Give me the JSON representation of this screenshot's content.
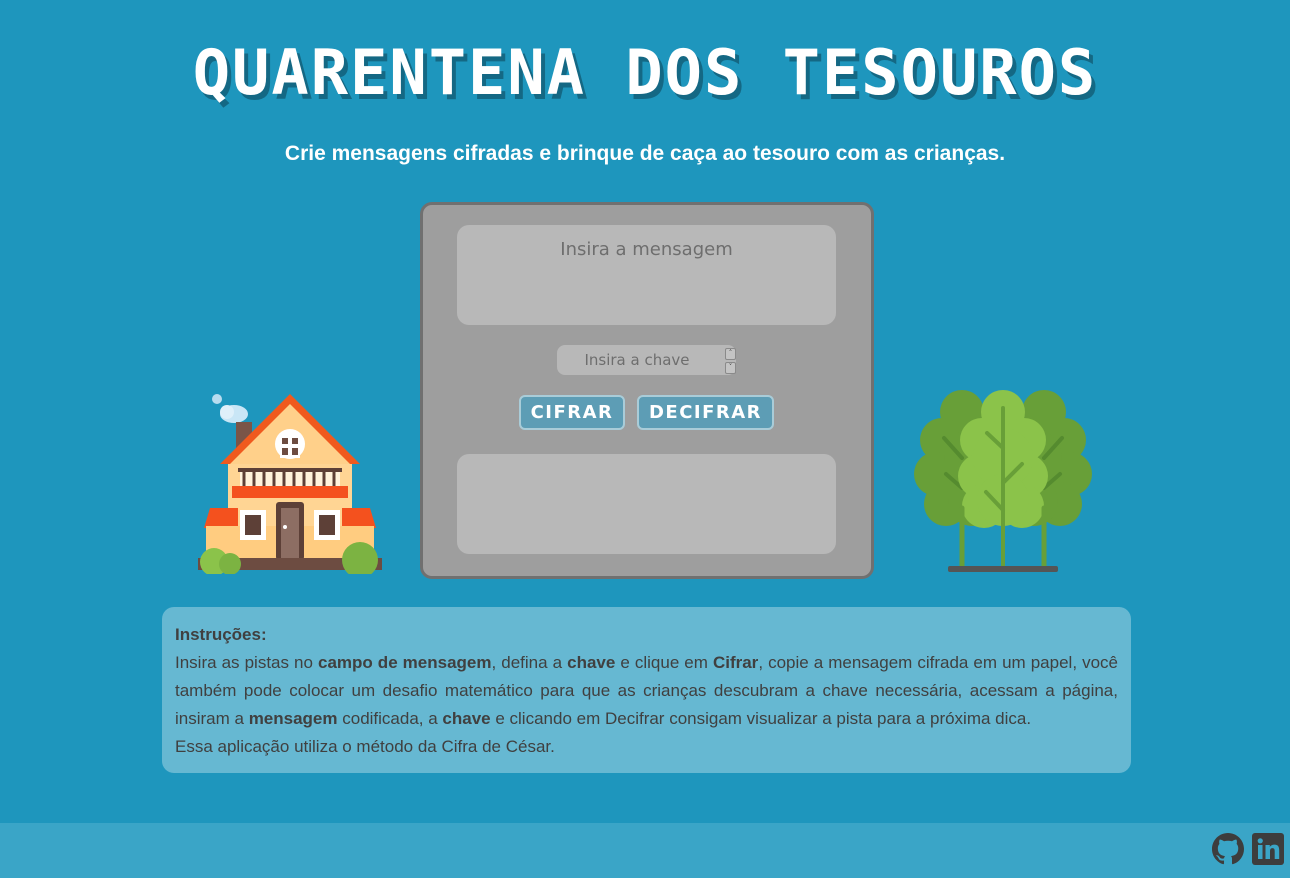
{
  "header": {
    "title": "QUARENTENA DOS TESOUROS",
    "subtitle": "Crie mensagens cifradas e brinque de caça ao tesouro com as crianças."
  },
  "cipher": {
    "message_placeholder": "Insira a mensagem",
    "message_value": "",
    "key_placeholder": "Insira a chave",
    "key_value": "",
    "encrypt_label": "CIFRAR",
    "decrypt_label": "DECIFRAR",
    "output_value": ""
  },
  "instructions": {
    "heading": "Instruções:",
    "segments": [
      "Insira as pistas no ",
      "campo de mensagem",
      ", defina a ",
      "chave",
      " e clique em ",
      "Cifrar",
      ", copie a mensagem cifrada em um papel, você também pode colocar um desafio matemático para que as crianças descubram a chave necessária, acessam a página, insiram a ",
      "mensagem",
      " codificada, a ",
      "chave",
      " e clicando em Decifrar consigam visualizar a pista para a próxima dica."
    ],
    "note": "Essa aplicação utiliza o método da Cifra de César."
  },
  "footer": {
    "icons": [
      "github-icon",
      "linkedin-icon"
    ]
  },
  "colors": {
    "background": "#1e96bd",
    "panel": "#9e9e9e",
    "field": "#b8b8b8",
    "button": "#5d9db5",
    "instructions_bg": "#66b8d2",
    "footer_bg": "#3aa5c7"
  }
}
